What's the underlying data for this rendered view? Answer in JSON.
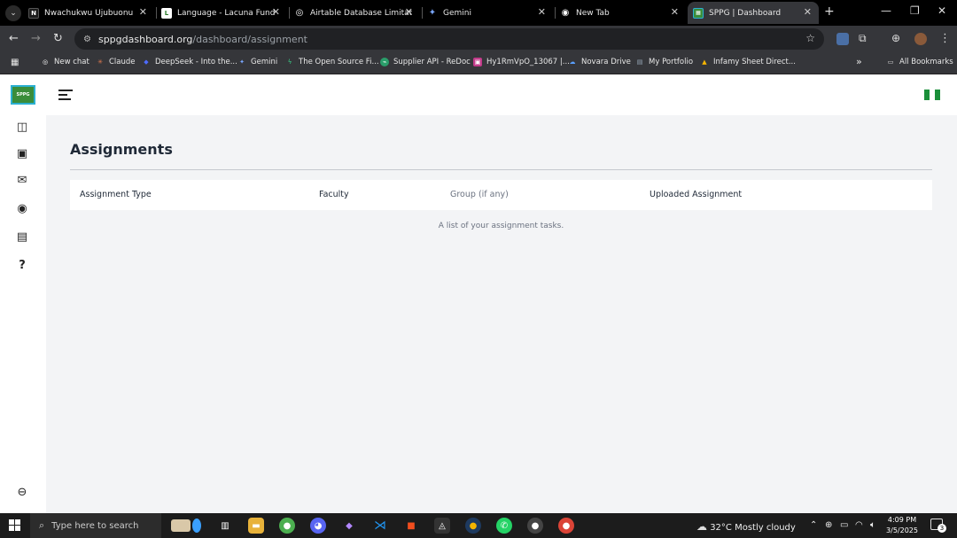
{
  "browser": {
    "tabs": [
      {
        "title": "Nwachukwu Ujubuonu",
        "favicon": "N",
        "active": false
      },
      {
        "title": "Language - Lacuna Fund",
        "favicon": "L",
        "active": false
      },
      {
        "title": "Airtable Database Limitat",
        "favicon": "◎",
        "active": false
      },
      {
        "title": "Gemini",
        "favicon": "✦",
        "active": false
      },
      {
        "title": "New Tab",
        "favicon": "◉",
        "active": false
      },
      {
        "title": "SPPG | Dashboard",
        "favicon": "▦",
        "active": true
      }
    ],
    "url_host": "sppgdashboard.org",
    "url_path": "/dashboard/assignment",
    "bookmarks": [
      {
        "label": "New chat",
        "icon": "◎"
      },
      {
        "label": "Claude",
        "icon": "✳"
      },
      {
        "label": "DeepSeek - Into the...",
        "icon": "◆"
      },
      {
        "label": "Gemini",
        "icon": "✦"
      },
      {
        "label": "The Open Source Fi...",
        "icon": "ϟ"
      },
      {
        "label": "Supplier API - ReDoc",
        "icon": "⌁"
      },
      {
        "label": "Hy1RmVpO_13067 |...",
        "icon": "▣"
      },
      {
        "label": "Novara Drive",
        "icon": "☁"
      },
      {
        "label": "My Portfolio",
        "icon": "▤"
      },
      {
        "label": "Infamy Sheet Direct...",
        "icon": "▲"
      }
    ],
    "bookmarks_overflow": "»",
    "all_bookmarks": "All Bookmarks"
  },
  "app": {
    "logo_text": "SPPG",
    "page_title": "Assignments",
    "table_headers": [
      "Assignment Type",
      "Faculty",
      "Group (if any)",
      "Uploaded Assignment"
    ],
    "caption": "A list of your assignment tasks."
  },
  "taskbar": {
    "search_placeholder": "Type here to search",
    "weather": "32°C  Mostly cloudy",
    "time": "4:09 PM",
    "date": "3/5/2025",
    "notification_count": "3"
  }
}
